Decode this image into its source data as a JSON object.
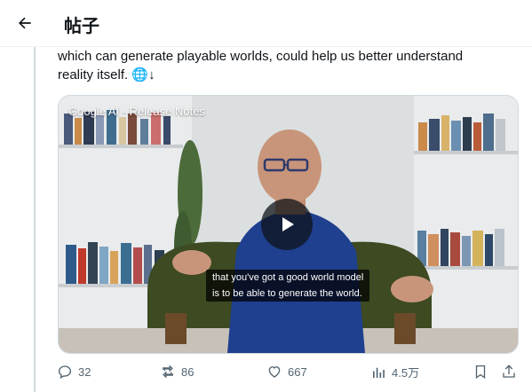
{
  "header": {
    "title": "帖子"
  },
  "tweet": {
    "text_line1": "which can generate playable worlds, could help us better understand",
    "text_line2": "reality itself.",
    "emoji": "🌐",
    "arrow": "↓"
  },
  "video": {
    "source_label": "Google AI - Release Notes",
    "caption_line1": "that you've got a good world model",
    "caption_line2": "is to be able to generate the world."
  },
  "actions": {
    "replies": "32",
    "reposts": "86",
    "likes": "667",
    "views": "4.5万"
  },
  "colors": {
    "text": "#0f1419",
    "secondary": "#536471",
    "shirt": "#1f3f8f",
    "chair": "#3d4a22"
  },
  "icons": [
    "back-arrow-icon",
    "play-icon",
    "reply-icon",
    "repost-icon",
    "like-icon",
    "views-icon",
    "bookmark-icon",
    "share-icon"
  ]
}
